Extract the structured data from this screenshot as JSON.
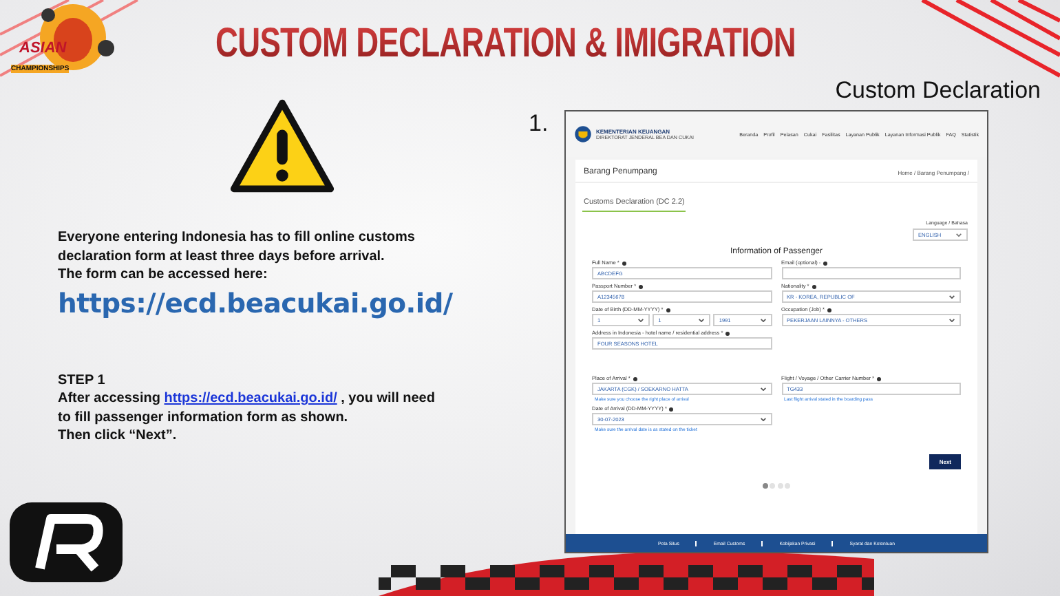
{
  "header": {
    "logo": {
      "line_1": "ASIAN",
      "line_2": "CHAMPIONSHIPS"
    },
    "title": "CUSTOM DECLARATION & IMIGRATION"
  },
  "intro": {
    "text": "Everyone entering Indonesia has to fill online customs declaration form at least three days before arrival.",
    "access": "The form can be accessed here:",
    "link": "https://ecd.beacukai.go.id/"
  },
  "step": {
    "heading": "STEP 1",
    "before": "After accessing",
    "link": "https://ecd.beacukai.go.id/",
    "after": ", you will need to fill passenger information form as shown.",
    "closing": "Then click “Next”."
  },
  "figure": {
    "caption": "Custom Declaration",
    "number": "1.",
    "site": {
      "ministry": "KEMENTERIAN KEUANGAN",
      "directorate": "DIREKTORAT JENDERAL BEA DAN CUKAI",
      "nav": [
        "Beranda",
        "Profil",
        "Pelasan",
        "Cukai",
        "Fasilitas",
        "Layanan Publik",
        "Layanan Informasi Publik",
        "FAQ",
        "Statistik"
      ],
      "page_title": "Barang Penumpang",
      "breadcrumb": "Home / Barang Penumpang /",
      "tab": "Customs Declaration (DC 2.2)",
      "language": {
        "label": "Language / Bahasa",
        "value": "ENGLISH"
      },
      "form_title": "Information of Passenger",
      "sections": [
        {
          "rows": [
            [
              {
                "kind": "text",
                "label": "Full Name *",
                "value": "ABCDEFG"
              },
              {
                "kind": "text",
                "label": "Email (optional) -"
              }
            ],
            [
              {
                "kind": "text",
                "label": "Passport Number *",
                "value": "A12345678"
              },
              {
                "kind": "select",
                "label": "Nationality *",
                "value": "KR - KOREA, REPUBLIC OF"
              }
            ],
            [
              {
                "kind": "date_parts",
                "label": "Date of Birth (DD-MM-YYYY) *",
                "parts": [
                  "1",
                  "1",
                  "1991"
                ]
              },
              {
                "kind": "select",
                "label": "Occupation (Job) *",
                "value": "PEKERJAAN LAINNYA - OTHERS"
              }
            ],
            [
              {
                "kind": "text",
                "label": "Address in Indonesia - hotel name / residential address *",
                "value": "FOUR SEASONS HOTEL"
              }
            ]
          ]
        },
        {
          "rows": [
            [
              {
                "kind": "select",
                "label": "Place of Arrival *",
                "value": "JAKARTA (CGK) / SOEKARNO HATTA",
                "hint": "Make sure you choose the right place of arrival"
              },
              {
                "kind": "text",
                "label": "Flight / Voyage / Other Carrier Number *",
                "value": "TG433",
                "hint": "Last flight arrival stated in the boarding pass"
              }
            ],
            [
              {
                "kind": "select",
                "label": "Date of Arrival (DD-MM-YYYY) *",
                "value": "30-07-2023",
                "hint": "Make sure the arrival date is as stated on the ticket"
              }
            ]
          ]
        }
      ],
      "next": "Next",
      "pages": [
        {
          "selected": true
        },
        {
          "selected": false
        },
        {
          "selected": false
        },
        {
          "selected": false
        }
      ],
      "footer": [
        "Peta Situs",
        "Email Customs",
        "Kebijakan Privasi",
        "Syarat dan Ketentuan"
      ]
    }
  }
}
